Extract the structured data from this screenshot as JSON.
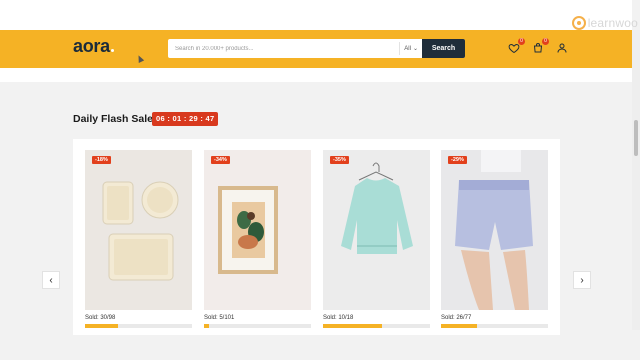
{
  "watermark": {
    "text": "learnwoo"
  },
  "header": {
    "logo": "aora",
    "search": {
      "placeholder": "Search in 20.000+ products...",
      "category": "All",
      "button": "Search"
    },
    "wishlist_count": "0",
    "cart_count": "0",
    "icons": [
      "heart-icon",
      "cart-icon",
      "user-icon"
    ]
  },
  "flash_sale": {
    "title": "Daily Flash Sale",
    "timer": "06 : 01 : 29 : 47",
    "products": [
      {
        "discount": "-18%",
        "sold": "Sold: 30/98",
        "progress": 0.306
      },
      {
        "discount": "-34%",
        "sold": "Sold: 5/101",
        "progress": 0.05
      },
      {
        "discount": "-35%",
        "sold": "Sold: 10/18",
        "progress": 0.556
      },
      {
        "discount": "-29%",
        "sold": "Sold: 26/77",
        "progress": 0.338
      }
    ],
    "prev_label": "‹",
    "next_label": "›"
  },
  "colors": {
    "brand_yellow": "#f5b225",
    "search_button": "#1f2d3a",
    "timer_red": "#d8391e"
  }
}
